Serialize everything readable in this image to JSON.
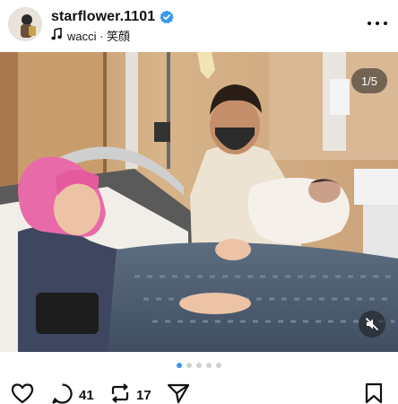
{
  "post": {
    "username": "starflower.1101",
    "music": "wacci · 笑顔",
    "counter": "1/5",
    "comments_count": "41",
    "reposts_count": "17"
  },
  "carousel": {
    "total": 5,
    "active_index": 0
  },
  "colors": {
    "accent": "#3897f0",
    "verified": "#3897f0"
  },
  "icons": [
    "verified-badge-icon",
    "music-note-icon",
    "more-options-icon",
    "mute-icon",
    "heart-icon",
    "comment-icon",
    "repost-icon",
    "share-icon",
    "bookmark-icon"
  ]
}
